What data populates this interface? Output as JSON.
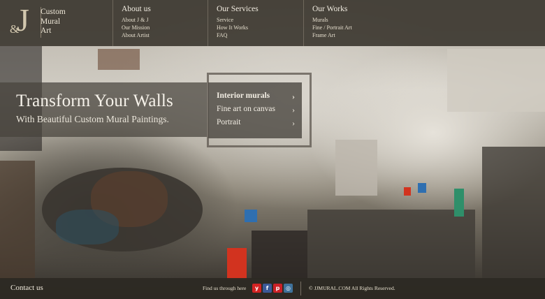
{
  "logo": {
    "amp": "&",
    "letter": "J",
    "name_lines": [
      "Custom",
      "Mural",
      "Art"
    ]
  },
  "nav": [
    {
      "heading": "About us",
      "links": [
        "About J & J",
        "Our Mission",
        "About Artist"
      ]
    },
    {
      "heading": "Our Services",
      "links": [
        "Service",
        "How It Works",
        "FAQ"
      ]
    },
    {
      "heading": "Our Works",
      "links": [
        "Murals",
        "Fine / Portrait Art",
        "Frame Art"
      ]
    }
  ],
  "hero": {
    "title": "Transform Your Walls",
    "subtitle": "With Beautiful Custom Mural Paintings."
  },
  "services_menu": {
    "items": [
      "Interior murals",
      "Fine art on canvas",
      "Portrait"
    ],
    "chevron": "›"
  },
  "footer": {
    "contact": "Contact us",
    "find_us": "Find us through here",
    "social": [
      {
        "icon": "yelp-icon",
        "glyph": "y",
        "color": "#d32323"
      },
      {
        "icon": "facebook-icon",
        "glyph": "f",
        "color": "#3b5998"
      },
      {
        "icon": "pinterest-icon",
        "glyph": "p",
        "color": "#cb2027"
      },
      {
        "icon": "instagram-icon",
        "glyph": "◎",
        "color": "#3f729b"
      }
    ],
    "copyright": "© JJMURAL.COM All Rights Reserved."
  }
}
